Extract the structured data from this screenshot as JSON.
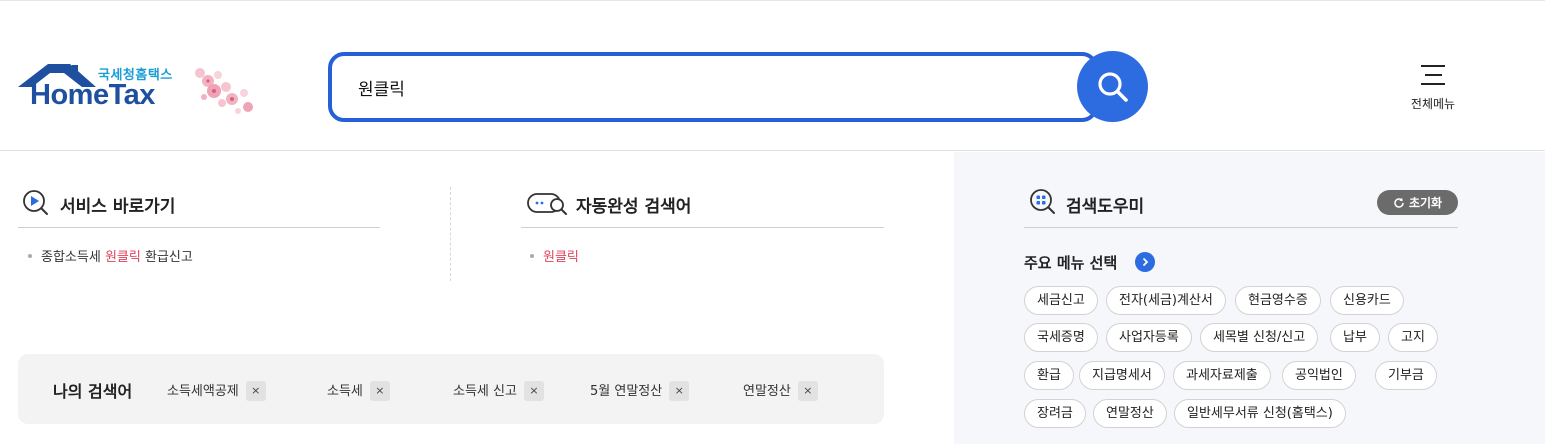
{
  "header": {
    "logo_ko": "국세청홈택스",
    "logo_en": "HomeTax",
    "search_value": "원클릭",
    "all_menu_label": "전체메뉴"
  },
  "service_shortcut": {
    "title": "서비스 바로가기",
    "items": [
      {
        "before": "종합소득세 ",
        "highlight": "원클릭",
        "after": " 환급신고"
      }
    ]
  },
  "autocomplete": {
    "title": "자동완성 검색어",
    "items": [
      "원클릭"
    ]
  },
  "my_searches": {
    "title": "나의 검색어",
    "items": [
      "소득세액공제",
      "소득세",
      "소득세 신고",
      "5월 연말정산",
      "연말정산"
    ],
    "remove_symbol": "×"
  },
  "search_helper": {
    "title": "검색도우미",
    "reset_label": "초기화",
    "menu_title": "주요 메뉴 선택",
    "tags": [
      "세금신고",
      "전자(세금)계산서",
      "현금영수증",
      "신용카드",
      "국세증명",
      "사업자등록",
      "세목별 신청/신고",
      "납부",
      "고지",
      "환급",
      "지급명세서",
      "과세자료제출",
      "공익법인",
      "기부금",
      "장려금",
      "연말정산",
      "일반세무서류 신청(홈택스)"
    ]
  },
  "colors": {
    "accent": "#2c6be0",
    "search_border": "#2660d9",
    "highlight": "#e0435b",
    "logo_blue": "#1f4f9f",
    "logo_cyan": "#1a9dd9"
  }
}
